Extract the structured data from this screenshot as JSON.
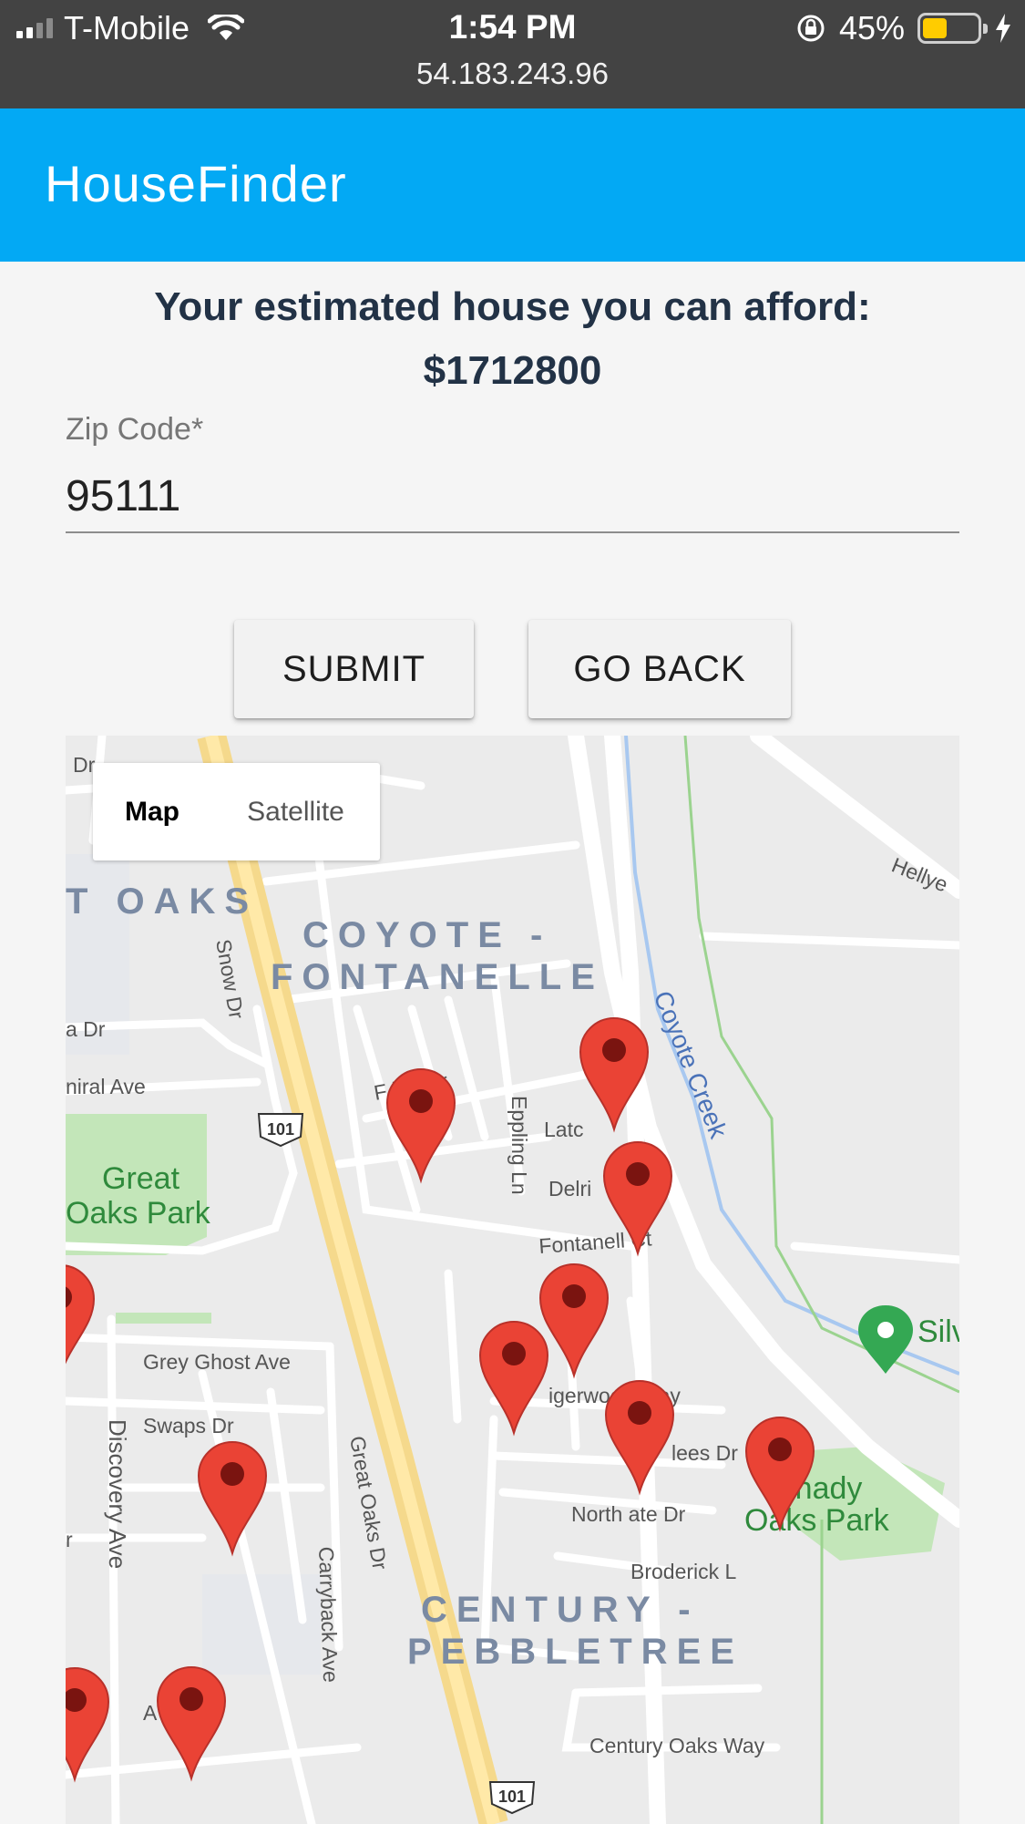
{
  "status_bar": {
    "carrier": "T-Mobile",
    "time": "1:54 PM",
    "url": "54.183.243.96",
    "battery_percent": "45%",
    "battery_level": 0.45,
    "icons": [
      "signal-icon",
      "wifi-icon",
      "orientation-lock-icon",
      "battery-icon",
      "charging-icon"
    ]
  },
  "app": {
    "title": "HouseFinder",
    "brand_color": "#03a9f4"
  },
  "estimate": {
    "line1": "Your estimated house you can afford:",
    "amount": "$1712800"
  },
  "form": {
    "zip_label": "Zip Code*",
    "zip_value": "95111"
  },
  "buttons": {
    "submit": "SUBMIT",
    "go_back": "GO BACK"
  },
  "map": {
    "type_control": {
      "map": "Map",
      "satellite": "Satellite",
      "selected": "Map"
    },
    "areas": {
      "oaks": "T OAKS",
      "coyote_1": "COYOTE -",
      "coyote_2": "FONTANELLE",
      "century_1": "CENTURY -",
      "century_2": "PEBBLETREE"
    },
    "parks": {
      "great_oaks_1": "Great",
      "great_oaks_2": "Oaks Park",
      "shady_1": "Shady",
      "shady_2": "Oaks Park",
      "sil": "Silv"
    },
    "streets": {
      "dr_top": "Dr",
      "hellyer": "Hellye",
      "snow": "Snow Dr",
      "a_dr": "a Dr",
      "admiral": "niral Ave",
      "fashion": "F    ion Dr",
      "eppling": "Eppling Ln",
      "latc": "Latc",
      "delri": "Delri",
      "fontanelle_ct": "Fontanell  Ct",
      "coyote_creek": "Coyote Creek",
      "grey_ghost": "Grey Ghost Ave",
      "swaps": "Swaps Dr",
      "discovery": "Discovery Ave",
      "great_oaks_dr": "Great Oaks Dr",
      "carryback": "Carryback Ave",
      "tigerwood": "igerwood Way",
      "lees": "lees Dr",
      "northgate": "North  ate Dr",
      "broderick": "Broderick L",
      "century_oaks": "Century Oaks Way",
      "ave_bottom": "A          Ave",
      "r": "r",
      "highway": "101"
    },
    "marker_count": 11,
    "marker_color": "#ea4335"
  }
}
